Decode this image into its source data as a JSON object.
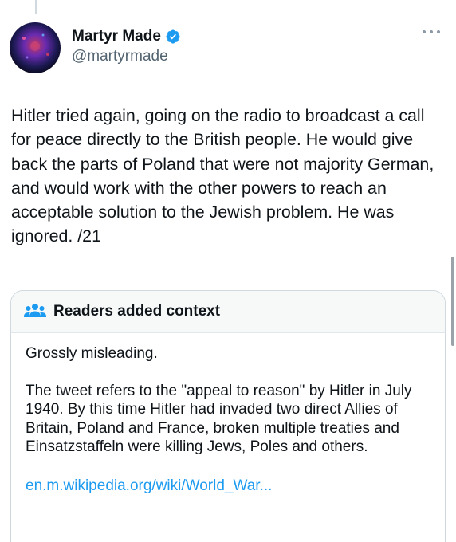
{
  "author": {
    "display_name": "Martyr Made",
    "handle": "@martyrmade",
    "verified": true,
    "avatar_icon": "avatar-image"
  },
  "tweet": {
    "text": "Hitler tried again, going on the radio to broadcast a call for peace directly to the British people. He would give back the parts of Poland that were not majority German, and would work with the other powers to reach an acceptable solution to the Jewish problem. He was ignored. /21"
  },
  "community_note": {
    "header": "Readers added context",
    "icon": "people-icon",
    "summary": "Grossly misleading.",
    "body": "The tweet refers to the \"appeal to reason\" by Hitler in July 1940. By this time Hitler had invaded two direct Allies of Britain, Poland and France, broken multiple treaties and Einsatzstaffeln were killing Jews, Poles and others.",
    "link": "en.m.wikipedia.org/wiki/World_War..."
  },
  "colors": {
    "link": "#1d9bf0",
    "verified": "#1d9bf0",
    "muted": "#536471",
    "border": "#cfd9de"
  }
}
